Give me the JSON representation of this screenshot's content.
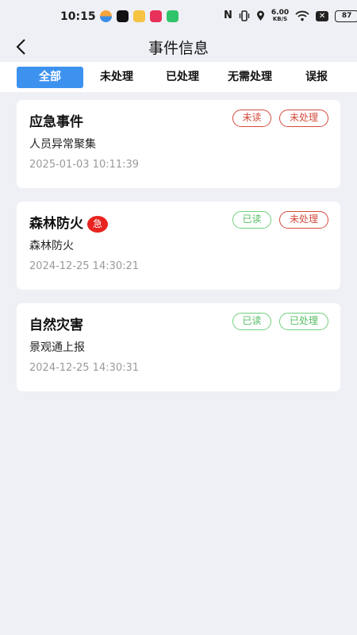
{
  "status_bar": {
    "time": "10:15",
    "net_speed_value": "6.00",
    "net_speed_unit": "KB/S",
    "battery": "87",
    "nfc_glyph": "N",
    "close_glyph": "✕"
  },
  "header": {
    "title": "事件信息"
  },
  "tabs": [
    {
      "label": "全部",
      "active": true
    },
    {
      "label": "未处理",
      "active": false
    },
    {
      "label": "已处理",
      "active": false
    },
    {
      "label": "无需处理",
      "active": false
    },
    {
      "label": "误报",
      "active": false
    }
  ],
  "events": [
    {
      "title": "应急事件",
      "urgent_label": "",
      "description": "人员异常聚集",
      "time": "2025-01-03 10:11:39",
      "read_status": "未读",
      "process_status": "未处理"
    },
    {
      "title": "森林防火",
      "urgent_label": "急",
      "description": "森林防火",
      "time": "2024-12-25 14:30:21",
      "read_status": "已读",
      "process_status": "未处理"
    },
    {
      "title": "自然灾害",
      "urgent_label": "",
      "description": "景观通上报",
      "time": "2024-12-25 14:30:31",
      "read_status": "已读",
      "process_status": "已处理"
    }
  ],
  "colors": {
    "accent": "#3d92f0",
    "unread_red": "#d44a3c",
    "read_green": "#55bd63",
    "urgent_red": "#e8231f",
    "background": "#eff0f5"
  }
}
